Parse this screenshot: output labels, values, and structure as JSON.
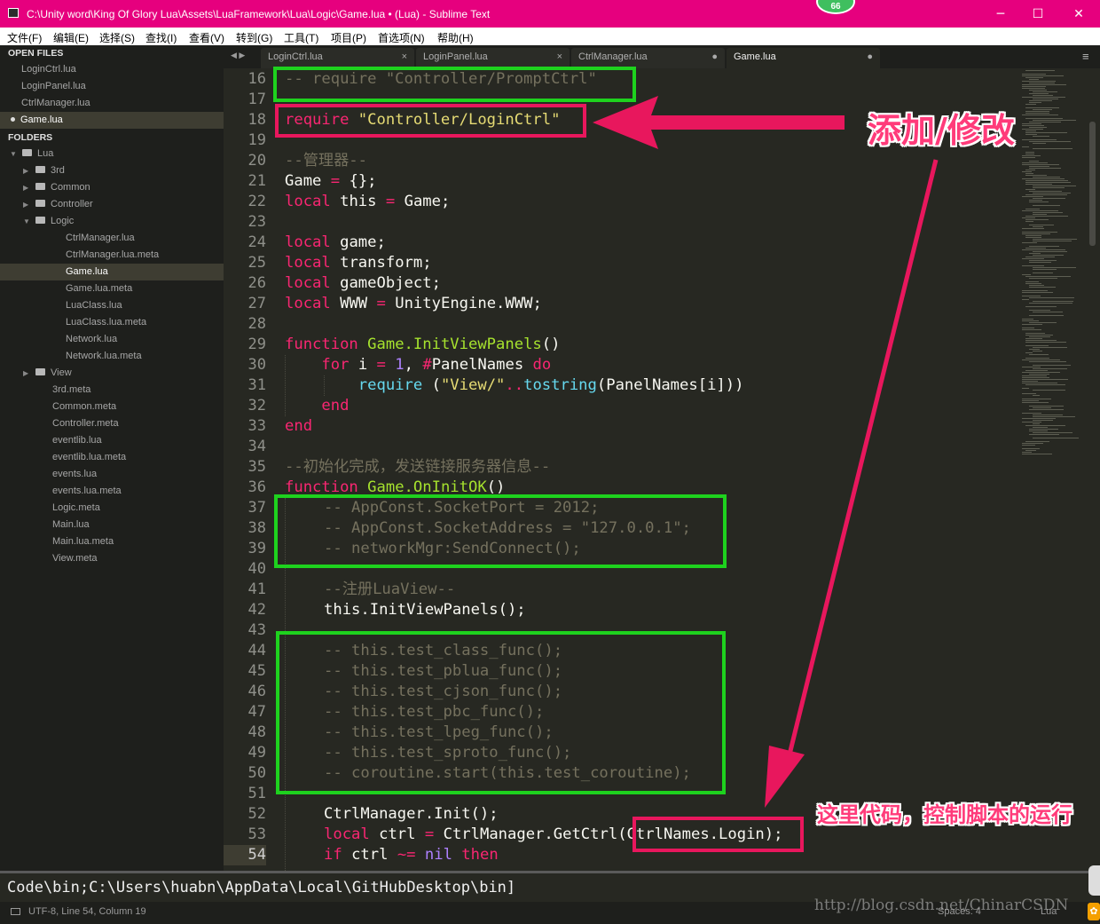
{
  "window": {
    "title": "C:\\Unity word\\King Of Glory Lua\\Assets\\LuaFramework\\Lua\\Logic\\Game.lua • (Lua) - Sublime Text",
    "badge": "66",
    "minimize": "─",
    "maximize": "☐",
    "close": "✕"
  },
  "menu": [
    "文件(F)",
    "编辑(E)",
    "选择(S)",
    "查找(I)",
    "查看(V)",
    "转到(G)",
    "工具(T)",
    "项目(P)",
    "首选项(N)",
    "帮助(H)"
  ],
  "sidebar": {
    "open_files_header": "OPEN FILES",
    "open_files": [
      "LoginCtrl.lua",
      "LoginPanel.lua",
      "CtrlManager.lua",
      "Game.lua"
    ],
    "folders_header": "FOLDERS",
    "tree": [
      {
        "label": "Lua"
      },
      {
        "label": "3rd"
      },
      {
        "label": "Common"
      },
      {
        "label": "Controller"
      },
      {
        "label": "Logic"
      },
      {
        "label": "CtrlManager.lua"
      },
      {
        "label": "CtrlManager.lua.meta"
      },
      {
        "label": "Game.lua"
      },
      {
        "label": "Game.lua.meta"
      },
      {
        "label": "LuaClass.lua"
      },
      {
        "label": "LuaClass.lua.meta"
      },
      {
        "label": "Network.lua"
      },
      {
        "label": "Network.lua.meta"
      },
      {
        "label": "View"
      },
      {
        "label": "3rd.meta"
      },
      {
        "label": "Common.meta"
      },
      {
        "label": "Controller.meta"
      },
      {
        "label": "eventlib.lua"
      },
      {
        "label": "eventlib.lua.meta"
      },
      {
        "label": "events.lua"
      },
      {
        "label": "events.lua.meta"
      },
      {
        "label": "Logic.meta"
      },
      {
        "label": "Main.lua"
      },
      {
        "label": "Main.lua.meta"
      },
      {
        "label": "View.meta"
      }
    ]
  },
  "tabs": [
    {
      "label": "LoginCtrl.lua",
      "close": "×"
    },
    {
      "label": "LoginPanel.lua",
      "close": "×"
    },
    {
      "label": "CtrlManager.lua",
      "close": "●"
    },
    {
      "label": "Game.lua",
      "close": "●"
    }
  ],
  "tab_nav": "◀ ▶",
  "tab_menu": "≡",
  "line_numbers": [
    "16",
    "17",
    "18",
    "19",
    "20",
    "21",
    "22",
    "23",
    "24",
    "25",
    "26",
    "27",
    "28",
    "29",
    "30",
    "31",
    "32",
    "33",
    "34",
    "35",
    "36",
    "37",
    "38",
    "39",
    "40",
    "41",
    "42",
    "43",
    "44",
    "45",
    "46",
    "47",
    "48",
    "49",
    "50",
    "51",
    "52",
    "53",
    "54"
  ],
  "code": {
    "l16": "-- require \"Controller/PromptCtrl\"",
    "l18_kw": "require",
    "l18_str": "\"Controller/LoginCtrl\"",
    "l20": "--管理器--",
    "l21_a": "Game",
    "l21_b": "=",
    "l21_c": "{};",
    "l22_a": "local",
    "l22_b": "this",
    "l22_c": "=",
    "l22_d": "Game;",
    "l24_a": "local",
    "l24_b": "game;",
    "l25_a": "local",
    "l25_b": "transform;",
    "l26_a": "local",
    "l26_b": "gameObject;",
    "l27_a": "local",
    "l27_b": "WWW",
    "l27_c": "=",
    "l27_d": "UnityEngine.WWW;",
    "l29_a": "function",
    "l29_b": "Game.InitViewPanels",
    "l29_c": "()",
    "l30_a": "for",
    "l30_b": "i",
    "l30_c": "=",
    "l30_d": "1",
    "l30_e": ",",
    "l30_f": "#",
    "l30_g": "PanelNames",
    "l30_h": "do",
    "l31_a": "require",
    "l31_b": "(",
    "l31_c": "\"View/\"",
    "l31_d": "..",
    "l31_e": "tostring",
    "l31_f": "(PanelNames[i]))",
    "l32": "end",
    "l33": "end",
    "l35": "--初始化完成，发送链接服务器信息--",
    "l36_a": "function",
    "l36_b": "Game.OnInitOK",
    "l36_c": "()",
    "l37": "-- AppConst.SocketPort = 2012;",
    "l38": "-- AppConst.SocketAddress = \"127.0.0.1\";",
    "l39": "-- networkMgr:SendConnect();",
    "l41": "--注册LuaView--",
    "l42": "this.InitViewPanels();",
    "l44": "-- this.test_class_func();",
    "l45": "-- this.test_pblua_func();",
    "l46": "-- this.test_cjson_func();",
    "l47": "-- this.test_pbc_func();",
    "l48": "-- this.test_lpeg_func();",
    "l49": "-- this.test_sproto_func();",
    "l50": "-- coroutine.start(this.test_coroutine);",
    "l52": "CtrlManager.Init();",
    "l53_a": "local",
    "l53_b": "ctrl",
    "l53_c": "=",
    "l53_d": "CtrlManager.GetCtrl(CtrlNames.Login);",
    "l54_a": "if",
    "l54_b": "ctrl",
    "l54_c": "~=",
    "l54_d": "nil",
    "l54_e": "then"
  },
  "console": "Code\\bin;C:\\Users\\huabn\\AppData\\Local\\GitHubDesktop\\bin]",
  "status": {
    "left": "UTF-8, Line 54, Column 19",
    "spaces": "Spaces: 4",
    "syntax": "Lua"
  },
  "watermark": "http://blog.csdn.net/ChinarCSDN",
  "annotations": {
    "add_modify": "添加/修改",
    "control_note": "这里代码，控制脚本的运行"
  },
  "colors": {
    "titlebar": "#e6007e",
    "green_box": "#1ed21e",
    "red_box": "#e8175d",
    "annotation": "#ff3b7a"
  }
}
